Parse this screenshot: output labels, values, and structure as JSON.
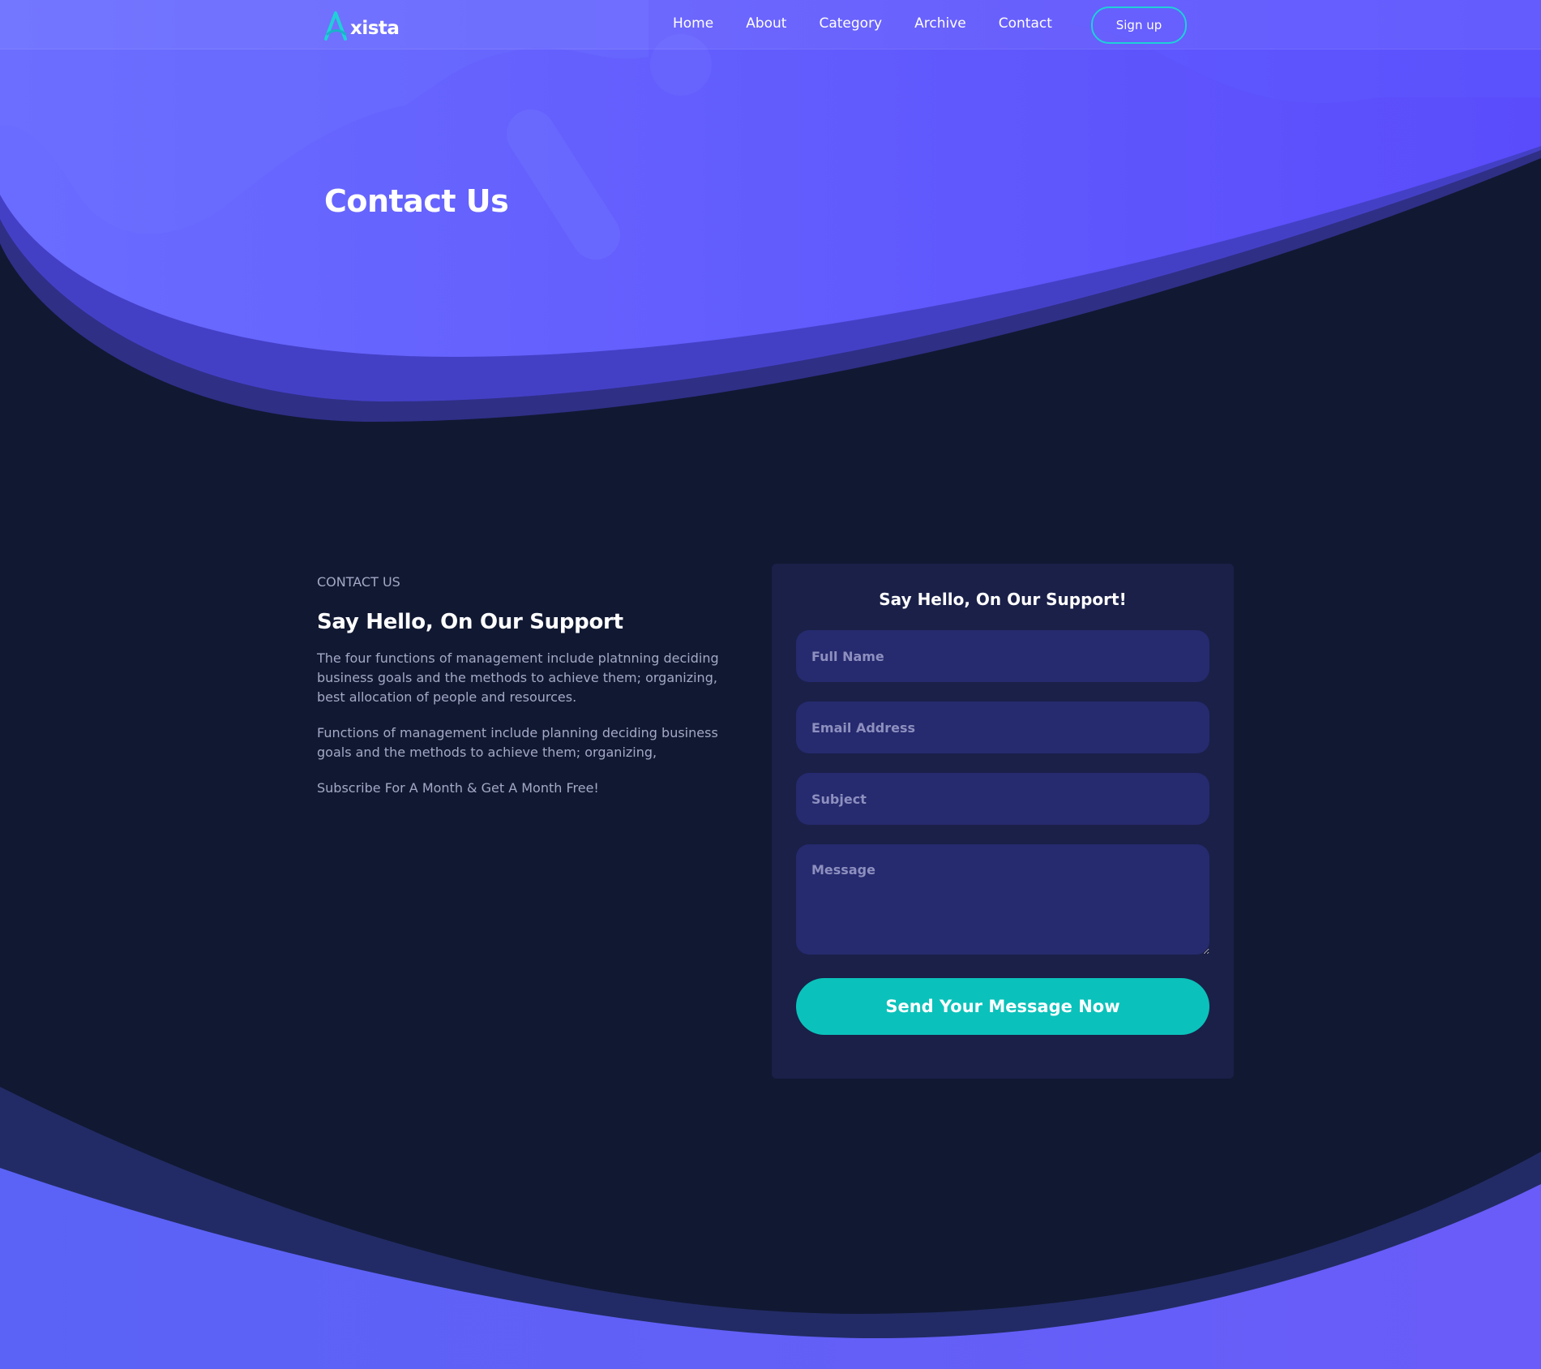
{
  "brand": {
    "name": "xista"
  },
  "nav": {
    "items": [
      "Home",
      "About",
      "Category",
      "Archive",
      "Contact"
    ],
    "signup_label": "Sign up"
  },
  "hero": {
    "title": "Contact Us"
  },
  "contact": {
    "eyebrow": "CONTACT US",
    "heading": "Say Hello, On Our Support",
    "paragraphs": [
      "The four functions of management include platnning deciding business goals and the methods to achieve them; organizing, best allocation of people and resources.",
      "Functions of management include planning deciding business goals and the methods to achieve them; organizing,",
      "Subscribe For A Month & Get A Month Free!"
    ]
  },
  "form": {
    "title": "Say Hello, On Our Support!",
    "full_name_placeholder": "Full Name",
    "email_placeholder": "Email Address",
    "subject_placeholder": "Subject",
    "message_placeholder": "Message",
    "submit_label": "Send Your Message Now"
  },
  "colors": {
    "hero_bg": "#5b56fe",
    "page_bg": "#111832",
    "card_bg": "#1a2048",
    "input_bg": "#262a6e",
    "accent": "#0ac2bb",
    "signup_border": "#1fd0d7",
    "eyebrow": "#f2546d"
  }
}
